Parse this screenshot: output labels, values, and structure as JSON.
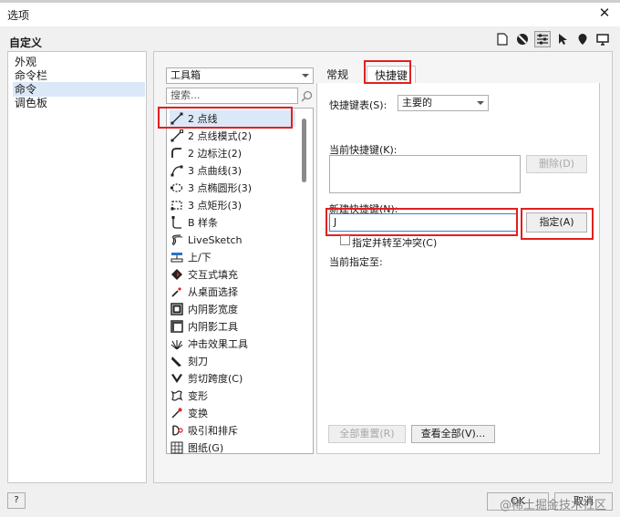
{
  "window": {
    "title": "选项",
    "close_glyph": "✕"
  },
  "heading": "自定义",
  "toolbar_icons": [
    "page-icon",
    "color-balls-icon",
    "sliders-icon",
    "pointer-icon",
    "pin-icon",
    "monitor-icon"
  ],
  "sidebar": {
    "items": [
      {
        "label": "外观",
        "selected": false
      },
      {
        "label": "命令栏",
        "selected": false
      },
      {
        "label": "命令",
        "selected": true
      },
      {
        "label": "调色板",
        "selected": false
      }
    ]
  },
  "commands": {
    "category": "工具箱",
    "search_placeholder": "搜索...",
    "items": [
      {
        "label": "2 点线",
        "icon": "two-point-line-icon",
        "selected": true
      },
      {
        "label": "2 点线模式(2)",
        "icon": "two-point-line-mode-icon"
      },
      {
        "label": "2 边标注(2)",
        "icon": "two-side-dimension-icon"
      },
      {
        "label": "3 点曲线(3)",
        "icon": "three-point-curve-icon"
      },
      {
        "label": "3 点椭圆形(3)",
        "icon": "three-point-ellipse-icon"
      },
      {
        "label": "3 点矩形(3)",
        "icon": "three-point-rectangle-icon"
      },
      {
        "label": "B 样条",
        "icon": "b-spline-icon"
      },
      {
        "label": "LiveSketch",
        "icon": "livesketch-icon"
      },
      {
        "label": "上/下",
        "icon": "up-down-icon"
      },
      {
        "label": "交互式填充",
        "icon": "interactive-fill-icon"
      },
      {
        "label": "从桌面选择",
        "icon": "eyedropper-icon"
      },
      {
        "label": "内阴影宽度",
        "icon": "inner-shadow-width-icon"
      },
      {
        "label": "内阴影工具",
        "icon": "inner-shadow-tool-icon"
      },
      {
        "label": "冲击效果工具",
        "icon": "impact-effect-icon"
      },
      {
        "label": "刻刀",
        "icon": "knife-icon"
      },
      {
        "label": "剪切跨度(C)",
        "icon": "cut-span-icon"
      },
      {
        "label": "变形",
        "icon": "distort-icon"
      },
      {
        "label": "变换",
        "icon": "transform-icon"
      },
      {
        "label": "吸引和排斥",
        "icon": "attract-repel-icon"
      },
      {
        "label": "图纸(G)",
        "icon": "graph-paper-icon"
      }
    ]
  },
  "tabs": [
    {
      "label": "常规",
      "active": false
    },
    {
      "label": "快捷键",
      "active": true
    }
  ],
  "shortcuts": {
    "table_label": "快捷键表(S):",
    "table_value": "主要的",
    "current_label": "当前快捷键(K):",
    "delete_button": "删除(D)",
    "new_label": "新建快捷键(N):",
    "new_value": "J",
    "assign_button": "指定(A)",
    "conflict_checkbox": "指定并转至冲突(C)",
    "conflict_checked": false,
    "current_assigned_label": "当前指定至:",
    "reset_all_button": "全部重置(R)",
    "view_all_button": "查看全部(V)..."
  },
  "footer": {
    "help_label": "?",
    "ok_label": "OK",
    "cancel_label": "取消"
  },
  "watermark": "@稀土掘金技术社区",
  "colors": {
    "highlight": "#e02020",
    "selection": "#dbe8f7"
  }
}
